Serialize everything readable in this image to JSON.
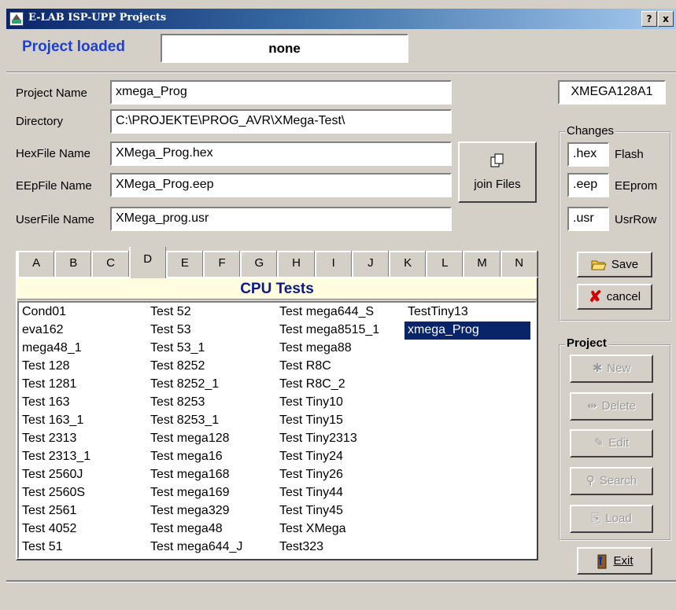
{
  "window": {
    "title": "E-LAB ISP-UPP Projects",
    "help_label": "?",
    "close_label": "x"
  },
  "status": {
    "label": "Project loaded",
    "value": "none"
  },
  "form": {
    "project_name_label": "Project Name",
    "project_name_value": "xmega_Prog",
    "directory_label": "Directory",
    "directory_value": "C:\\PROJEKTE\\PROG_AVR\\XMega-Test\\",
    "hexfile_label": "HexFile Name",
    "hexfile_value": "XMega_Prog.hex",
    "eepfile_label": "EEpFile Name",
    "eepfile_value": "XMega_Prog.eep",
    "userfile_label": "UserFile Name",
    "userfile_value": "XMega_prog.usr",
    "join_files_label": "join Files"
  },
  "device": "XMEGA128A1",
  "changes": {
    "title": "Changes",
    "rows": [
      {
        "ext": ".hex",
        "label": "Flash"
      },
      {
        "ext": ".eep",
        "label": "EEprom"
      },
      {
        "ext": ".usr",
        "label": "UsrRow"
      }
    ],
    "save_label": "Save",
    "cancel_label": "cancel"
  },
  "project": {
    "title": "Project",
    "new_label": "New",
    "delete_label": "Delete",
    "edit_label": "Edit",
    "search_label": "Search",
    "load_label": "Load"
  },
  "exit_label": "Exit",
  "tabs": [
    "A",
    "B",
    "C",
    "D",
    "E",
    "F",
    "G",
    "H",
    "I",
    "J",
    "K",
    "L",
    "M",
    "N"
  ],
  "active_tab": "D",
  "list": {
    "header": "CPU Tests",
    "selected": "xmega_Prog",
    "columns": [
      [
        "Cond01",
        "eva162",
        "mega48_1",
        "Test 128",
        "Test 1281",
        "Test 163",
        "Test 163_1",
        "Test 2313",
        "Test 2313_1",
        "Test 2560J",
        "Test 2560S",
        "Test 2561",
        "Test 4052",
        "Test 51"
      ],
      [
        "Test 52",
        "Test 53",
        "Test 53_1",
        "Test 8252",
        "Test 8252_1",
        "Test 8253",
        "Test 8253_1",
        "Test mega128",
        "Test mega16",
        "Test mega168",
        "Test mega169",
        "Test mega329",
        "Test mega48",
        "Test mega644_J"
      ],
      [
        "Test mega644_S",
        "Test mega8515_1",
        "Test mega88",
        "Test R8C",
        "Test R8C_2",
        "Test Tiny10",
        "Test Tiny15",
        "Test Tiny2313",
        "Test Tiny24",
        "Test Tiny26",
        "Test Tiny44",
        "Test Tiny45",
        "Test XMega",
        "Test323"
      ],
      [
        "TestTiny13",
        "xmega_Prog"
      ]
    ]
  },
  "colors": {
    "title_start": "#0a246a",
    "title_end": "#a6caf0",
    "status_label": "#1c3fd6",
    "selection": "#0a246a",
    "list_header_bg": "#fffde0",
    "header_text": "#0a1a8a"
  }
}
